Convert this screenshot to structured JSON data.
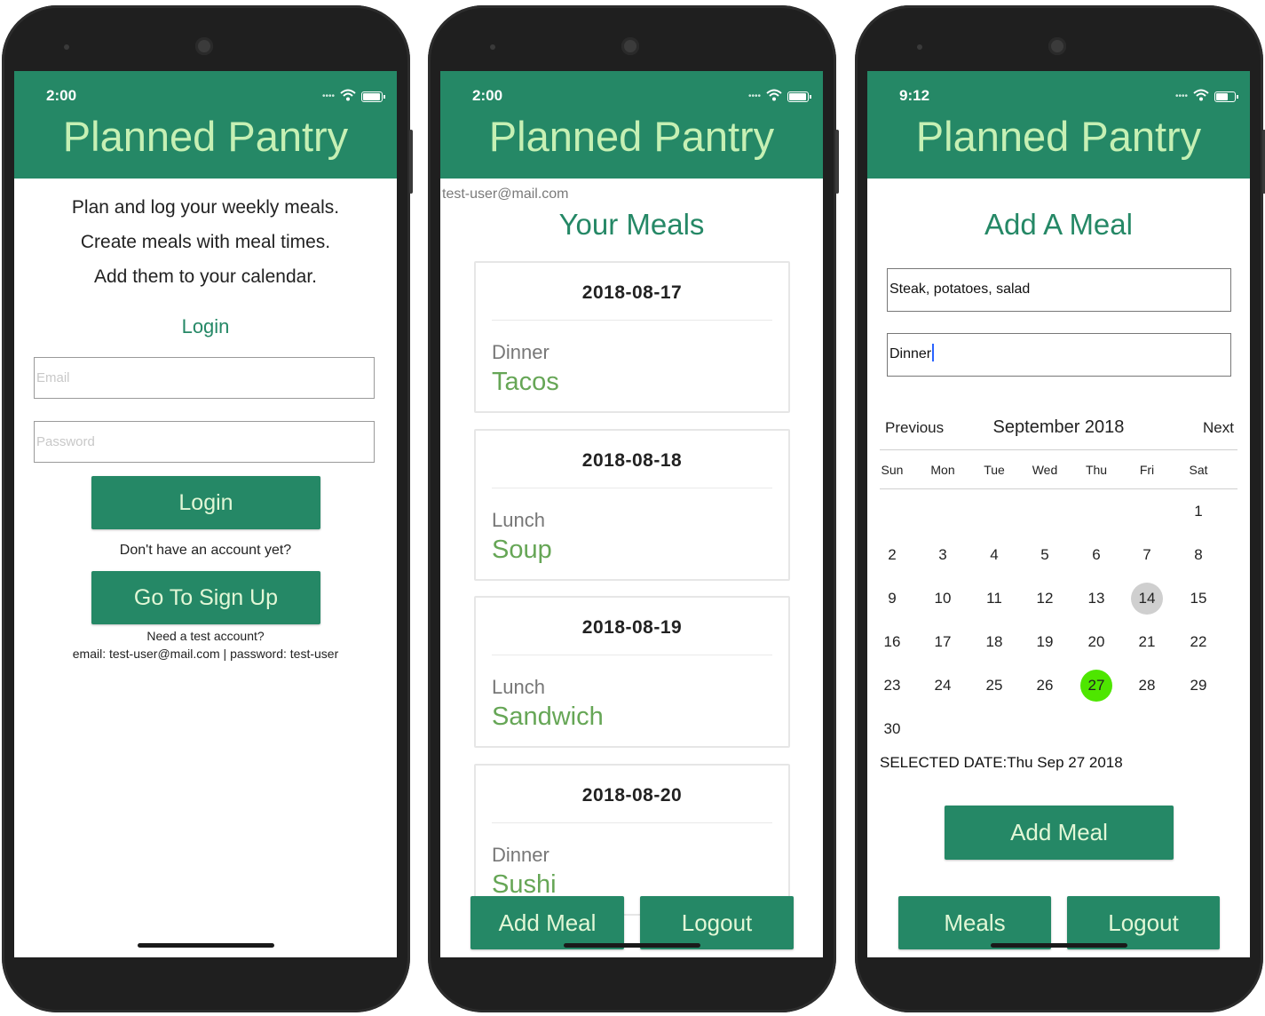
{
  "app": {
    "title": "Planned Pantry"
  },
  "phone1": {
    "status_time": "2:00",
    "intro": [
      "Plan and log your weekly meals.",
      "Create meals with meal times.",
      "Add them to your calendar."
    ],
    "login_heading": "Login",
    "email_placeholder": "Email",
    "password_placeholder": "Password",
    "login_button": "Login",
    "no_account_text": "Don't have an account yet?",
    "signup_button": "Go To Sign Up",
    "test_account_question": "Need a test account?",
    "test_account_credentials": "email: test-user@mail.com | password: test-user"
  },
  "phone2": {
    "status_time": "2:00",
    "user_email": "test-user@mail.com",
    "heading": "Your Meals",
    "meals": [
      {
        "date": "2018-08-17",
        "time": "Dinner",
        "name": "Tacos"
      },
      {
        "date": "2018-08-18",
        "time": "Lunch",
        "name": "Soup"
      },
      {
        "date": "2018-08-19",
        "time": "Lunch",
        "name": "Sandwich"
      },
      {
        "date": "2018-08-20",
        "time": "Dinner",
        "name": "Sushi"
      }
    ],
    "add_meal_button": "Add Meal",
    "logout_button": "Logout"
  },
  "phone3": {
    "status_time": "9:12",
    "heading": "Add A Meal",
    "meal_name_value": "Steak, potatoes, salad",
    "meal_time_value": "Dinner",
    "calendar": {
      "previous": "Previous",
      "month": "September 2018",
      "next": "Next",
      "weekdays": [
        "Sun",
        "Mon",
        "Tue",
        "Wed",
        "Thu",
        "Fri",
        "Sat"
      ],
      "weeks": [
        [
          "",
          "",
          "",
          "",
          "",
          "",
          "1"
        ],
        [
          "2",
          "3",
          "4",
          "5",
          "6",
          "7",
          "8"
        ],
        [
          "9",
          "10",
          "11",
          "12",
          "13",
          "14",
          "15"
        ],
        [
          "16",
          "17",
          "18",
          "19",
          "20",
          "21",
          "22"
        ],
        [
          "23",
          "24",
          "25",
          "26",
          "27",
          "28",
          "29"
        ],
        [
          "30",
          "",
          "",
          "",
          "",
          "",
          ""
        ]
      ],
      "today": "14",
      "selected": "27",
      "today_color": "#cfcfcf",
      "selected_color": "#4ee600"
    },
    "selected_date_text": "SELECTED DATE:Thu Sep 27 2018",
    "add_meal_button": "Add Meal",
    "meals_button": "Meals",
    "logout_button": "Logout"
  },
  "colors": {
    "brand": "#258866",
    "title_text": "#c6f0b4",
    "meal_name": "#66a656"
  },
  "icons": {
    "wifi": "wifi-icon",
    "battery": "battery-icon",
    "signal": "signal-icon"
  }
}
